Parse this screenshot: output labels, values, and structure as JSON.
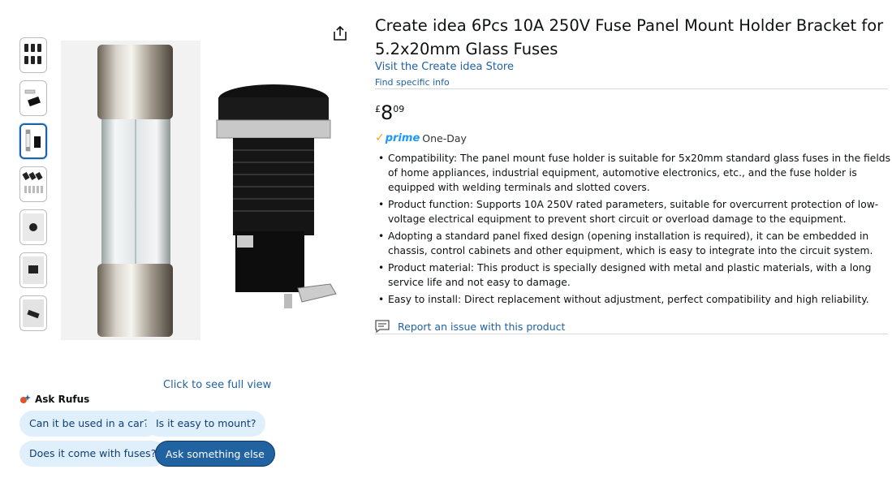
{
  "product": {
    "title": "Create idea 6Pcs 10A 250V Fuse Panel Mount Holder Bracket for 5.2x20mm Glass Fuses",
    "store_link": "Visit the Create idea Store",
    "find_info": "Find specific info",
    "price": {
      "symbol": "£",
      "whole": "8",
      "fraction": "09"
    },
    "delivery": {
      "prime_label": "prime",
      "speed": "One-Day"
    },
    "bullets": [
      "Compatibility: The panel mount fuse holder is suitable for 5x20mm standard glass fuses in the fields of home appliances, industrial equipment, automotive electronics, etc., and the fuse holder is equipped with welding terminals and slotted covers.",
      "Product function: Supports 10A 250V rated parameters, suitable for overcurrent protection of low-voltage electrical equipment to prevent short circuit or overload damage to the equipment.",
      "Adopting a standard panel fixed design (opening installation is required), it can be embedded in chassis, control cabinets and other equipment, which is easy to integrate into the circuit system.",
      "Product material: This product is specially designed with metal and plastic materials, with a long service life and not easy to damage.",
      "Easy to install: Direct replacement without adjustment, perfect compatibility and high reliability."
    ],
    "report_link": "Report an issue with this product"
  },
  "gallery": {
    "full_view": "Click to see full view",
    "selected_index": 2,
    "thumbnail_count": 7
  },
  "rufus": {
    "title": "Ask Rufus",
    "suggestions": [
      "Can it be used in a car?",
      "Is it easy to mount?",
      "Does it come with fuses?",
      "Ask something else"
    ]
  },
  "colors": {
    "link": "#2162a1",
    "pill_bg": "#dff0fc",
    "pill_dark": "#2162a1",
    "prime_blue": "#1a98ff",
    "prime_check": "#f7a31c"
  }
}
